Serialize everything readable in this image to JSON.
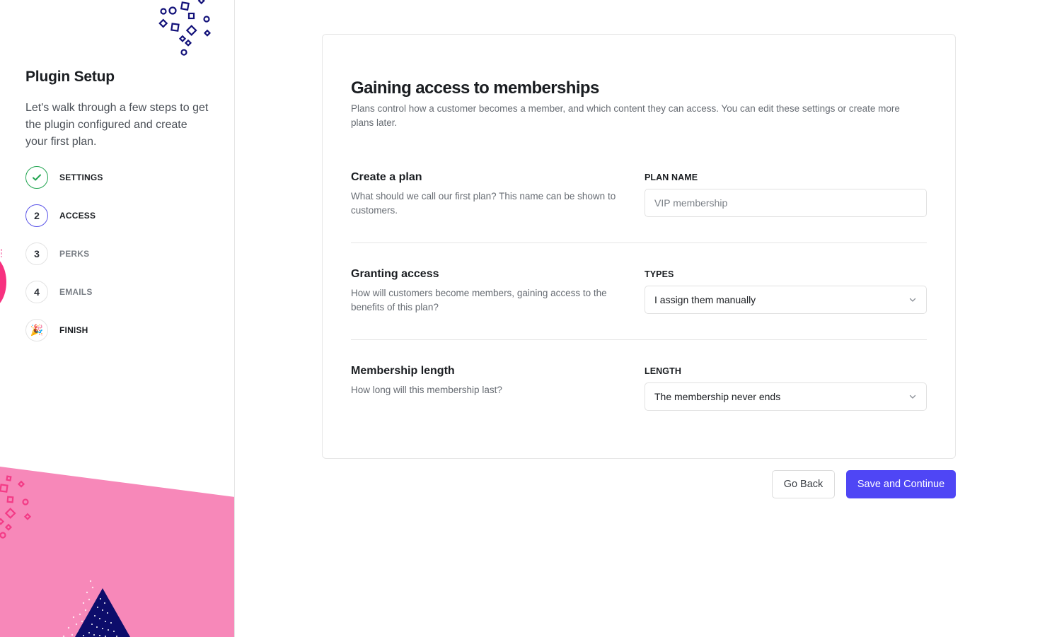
{
  "sidebar": {
    "title": "Plugin Setup",
    "description": "Let's walk through a few steps to get the plugin configured and create your first plan.",
    "steps": [
      {
        "marker": "✓",
        "label": "SETTINGS",
        "state": "complete"
      },
      {
        "marker": "2",
        "label": "ACCESS",
        "state": "current"
      },
      {
        "marker": "3",
        "label": "PERKS",
        "state": "upcoming"
      },
      {
        "marker": "4",
        "label": "EMAILS",
        "state": "upcoming"
      },
      {
        "marker": "🎉",
        "label": "FINISH",
        "state": "final"
      }
    ]
  },
  "main": {
    "title": "Gaining access to memberships",
    "description": "Plans control how a customer becomes a member, and which content they can access. You can edit these settings or create more plans later.",
    "sections": {
      "plan": {
        "title": "Create a plan",
        "description": "What should we call our first plan? This name can be shown to customers.",
        "field_label": "PLAN NAME",
        "value": "",
        "placeholder": "VIP membership"
      },
      "access": {
        "title": "Granting access",
        "description": "How will customers become members, gaining access to the benefits of this plan?",
        "field_label": "TYPES",
        "selected": "I assign them manually"
      },
      "length": {
        "title": "Membership length",
        "description": "How long will this membership last?",
        "field_label": "LENGTH",
        "selected": "The membership never ends"
      }
    }
  },
  "actions": {
    "back_label": "Go Back",
    "save_label": "Save and Continue"
  },
  "colors": {
    "accent": "#4f46f5",
    "complete": "#22a551",
    "pink": "#f788b9",
    "navy": "#0d0d6b"
  }
}
